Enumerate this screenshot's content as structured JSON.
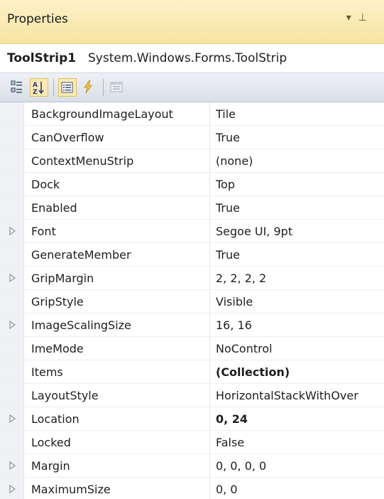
{
  "window": {
    "title": "Properties",
    "dropdown_glyph": "▾",
    "pin_glyph": "⊥"
  },
  "object": {
    "name": "ToolStrip1",
    "type": "System.Windows.Forms.ToolStrip"
  },
  "toolbar": {
    "buttons": [
      {
        "name": "categorized-icon",
        "active": false
      },
      {
        "name": "alphabetical-icon",
        "active": true
      },
      {
        "name": "properties-icon",
        "active": true
      },
      {
        "name": "events-icon",
        "active": false
      },
      {
        "name": "property-pages-icon",
        "active": false
      }
    ]
  },
  "properties": [
    {
      "name": "BackgroundImageLayout",
      "value": "Tile",
      "expandable": false,
      "bold": false
    },
    {
      "name": "CanOverflow",
      "value": "True",
      "expandable": false,
      "bold": false
    },
    {
      "name": "ContextMenuStrip",
      "value": "(none)",
      "expandable": false,
      "bold": false
    },
    {
      "name": "Dock",
      "value": "Top",
      "expandable": false,
      "bold": false
    },
    {
      "name": "Enabled",
      "value": "True",
      "expandable": false,
      "bold": false
    },
    {
      "name": "Font",
      "value": "Segoe UI, 9pt",
      "expandable": true,
      "bold": false
    },
    {
      "name": "GenerateMember",
      "value": "True",
      "expandable": false,
      "bold": false
    },
    {
      "name": "GripMargin",
      "value": "2, 2, 2, 2",
      "expandable": true,
      "bold": false
    },
    {
      "name": "GripStyle",
      "value": "Visible",
      "expandable": false,
      "bold": false
    },
    {
      "name": "ImageScalingSize",
      "value": "16, 16",
      "expandable": true,
      "bold": false
    },
    {
      "name": "ImeMode",
      "value": "NoControl",
      "expandable": false,
      "bold": false
    },
    {
      "name": "Items",
      "value": "(Collection)",
      "expandable": false,
      "bold": true
    },
    {
      "name": "LayoutStyle",
      "value": "HorizontalStackWithOver",
      "expandable": false,
      "bold": false
    },
    {
      "name": "Location",
      "value": "0, 24",
      "expandable": true,
      "bold": true
    },
    {
      "name": "Locked",
      "value": "False",
      "expandable": false,
      "bold": false
    },
    {
      "name": "Margin",
      "value": "0, 0, 0, 0",
      "expandable": true,
      "bold": false
    },
    {
      "name": "MaximumSize",
      "value": "0, 0",
      "expandable": true,
      "bold": false
    }
  ],
  "colors": {
    "title_bar": "#f7e4a0",
    "active_button": "#fbe9b1",
    "gutter": "#f0f1f4"
  }
}
